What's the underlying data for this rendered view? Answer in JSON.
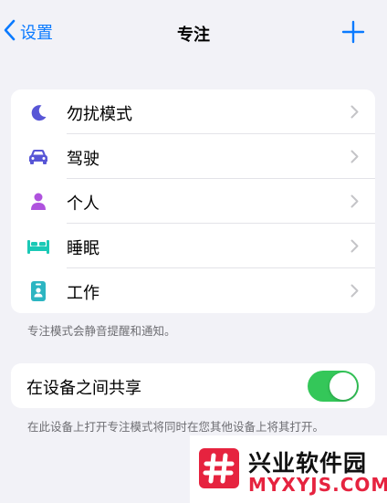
{
  "nav": {
    "back_label": "设置",
    "title": "专注",
    "add_icon": "plus-icon"
  },
  "focus_modes": [
    {
      "label": "勿扰模式",
      "icon": "moon-icon",
      "color": "#5856D6"
    },
    {
      "label": "驾驶",
      "icon": "car-icon",
      "color": "#5856D6"
    },
    {
      "label": "个人",
      "icon": "person-icon",
      "color": "#AF52DE"
    },
    {
      "label": "睡眠",
      "icon": "bed-icon",
      "color": "#1BC9B6"
    },
    {
      "label": "工作",
      "icon": "id-badge-icon",
      "color": "#2CB5C2"
    }
  ],
  "modes_footer": "专注模式会静音提醒和通知。",
  "share": {
    "label": "在设备之间共享",
    "enabled": true,
    "footer": "在此设备上打开专注模式将同时在您其他设备上将其打开。"
  },
  "watermark": {
    "name": "兴业软件园",
    "url": "MYXYJS.COM"
  },
  "colors": {
    "accent": "#0A7AFF",
    "toggle_on": "#34C759",
    "background": "#F2F2F7"
  }
}
